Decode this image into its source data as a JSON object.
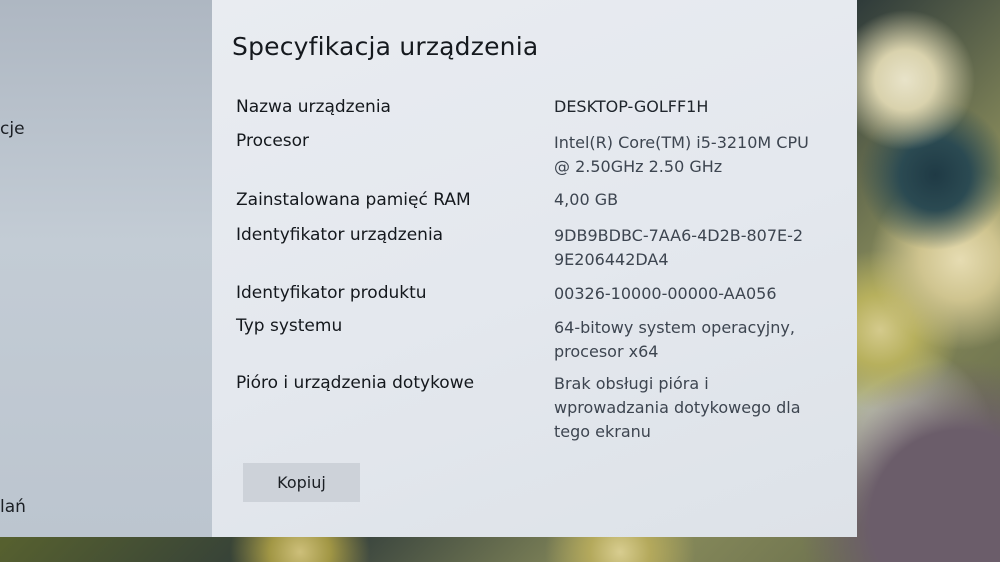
{
  "left_nav": {
    "item_partial_top": "cje",
    "item_partial_bottom": "lań"
  },
  "panel": {
    "title": "Specyfikacja urządzenia",
    "specs": [
      {
        "label": "Nazwa urządzenia",
        "value": "DESKTOP-GOLFF1H"
      },
      {
        "label": "Procesor",
        "value": "Intel(R) Core(TM) i5-3210M CPU @ 2.50GHz   2.50 GHz"
      },
      {
        "label": "Zainstalowana pamięć RAM",
        "value": "4,00 GB"
      },
      {
        "label": "Identyfikator urządzenia",
        "value": "9DB9BDBC-7AA6-4D2B-807E-29E206442DA4"
      },
      {
        "label": "Identyfikator produktu",
        "value": "00326-10000-00000-AA056"
      },
      {
        "label": "Typ systemu",
        "value": "64-bitowy system operacyjny, procesor x64"
      },
      {
        "label": "Pióro i urządzenia dotykowe",
        "value": "Brak obsługi pióra i wprowadzania dotykowego dla tego ekranu"
      }
    ],
    "copy_button_label": "Kopiuj"
  }
}
